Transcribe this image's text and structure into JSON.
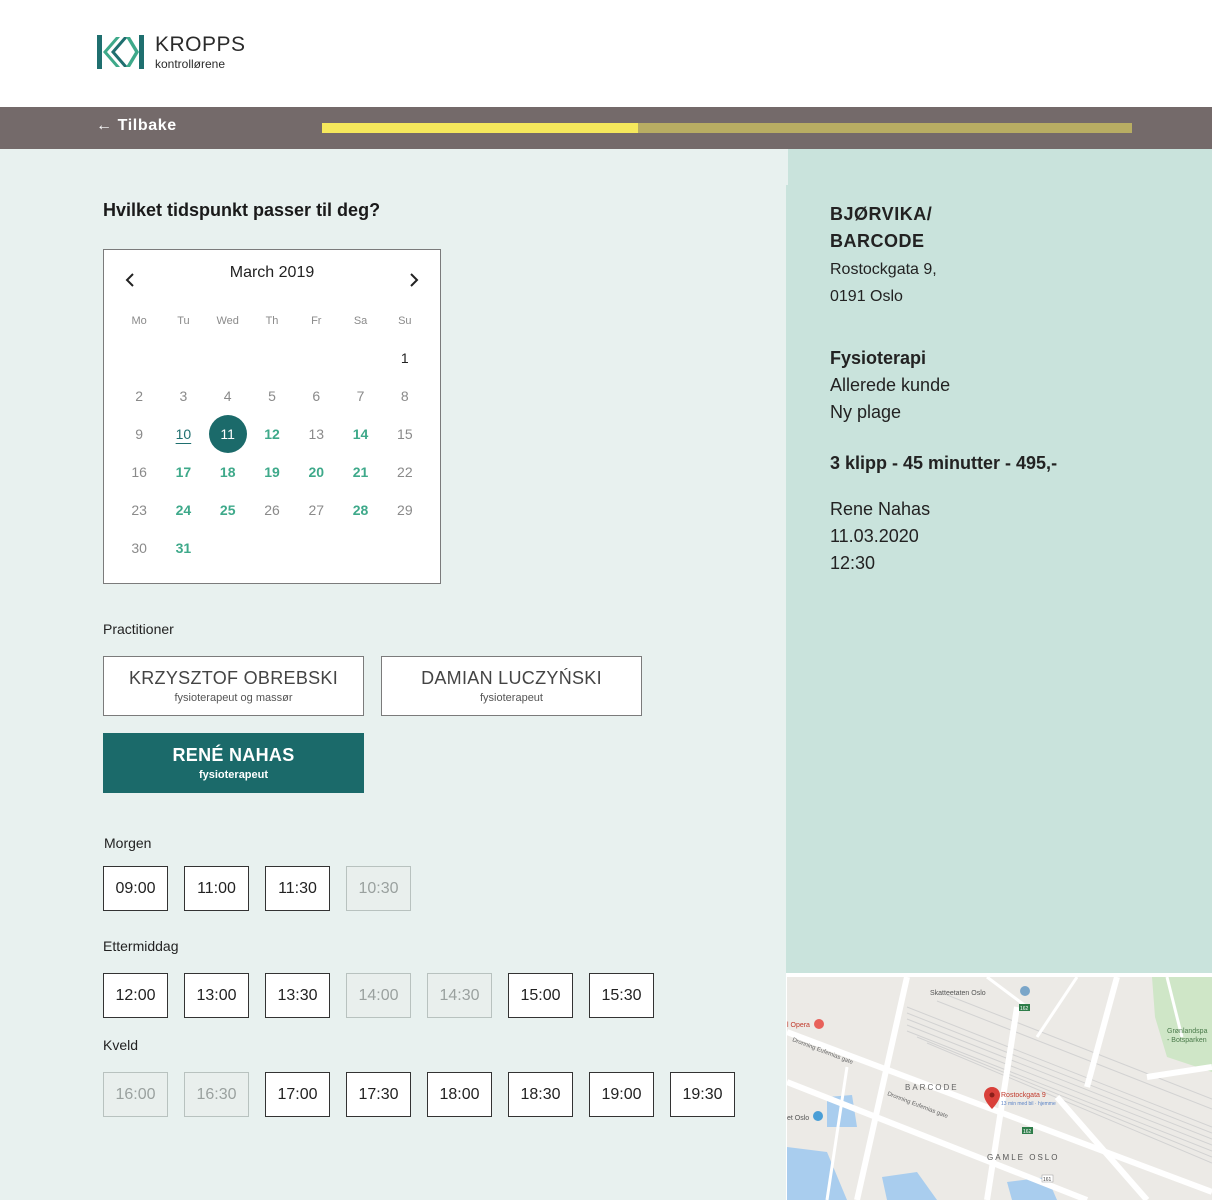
{
  "brand": {
    "title": "KROPPS",
    "subtitle": "kontrollørene"
  },
  "nav": {
    "back_label": "← Tilbake",
    "progress": 0.39
  },
  "colors": {
    "accent": "#1b6a6a",
    "available": "#3ea98a",
    "panel": "#c9e3dc",
    "bar": "#746a6a",
    "progress_fill": "#f5e85c",
    "progress_track": "#b8ad63"
  },
  "question": "Hvilket tidspunkt passer til deg?",
  "calendar": {
    "month_label": "March 2019",
    "prev_icon": "chevron-left-icon",
    "next_icon": "chevron-right-icon",
    "weekdays": [
      "Mo",
      "Tu",
      "Wed",
      "Th",
      "Fr",
      "Sa",
      "Su"
    ],
    "weeks": [
      [
        "",
        "",
        "",
        "",
        "",
        "",
        "1"
      ],
      [
        "2",
        "3",
        "4",
        "5",
        "6",
        "7",
        "8"
      ],
      [
        "9",
        "10",
        "11",
        "12",
        "13",
        "14",
        "15"
      ],
      [
        "16",
        "17",
        "18",
        "19",
        "20",
        "21",
        "22"
      ],
      [
        "23",
        "24",
        "25",
        "26",
        "27",
        "28",
        "29"
      ],
      [
        "30",
        "31",
        "",
        "",
        "",
        "",
        ""
      ]
    ],
    "selected": "11",
    "today": "10",
    "available": [
      "12",
      "14",
      "17",
      "18",
      "19",
      "20",
      "21",
      "24",
      "25",
      "28",
      "31"
    ],
    "normal": [
      "1"
    ]
  },
  "practitioner_label": "Practitioner",
  "practitioners": [
    {
      "name": "KRZYSZTOF OBREBSKI",
      "role": "fysioterapeut og massør",
      "selected": false
    },
    {
      "name": "DAMIAN LUCZYŃSKI",
      "role": "fysioterapeut",
      "selected": false
    },
    {
      "name": "RENÉ NAHAS",
      "role": "fysioterapeut",
      "selected": true
    }
  ],
  "time_groups": [
    {
      "label": "Morgen",
      "slots": [
        {
          "time": "09:00",
          "disabled": false
        },
        {
          "time": "11:00",
          "disabled": false
        },
        {
          "time": "11:30",
          "disabled": false
        },
        {
          "time": "10:30",
          "disabled": true
        }
      ]
    },
    {
      "label": "Ettermiddag",
      "slots": [
        {
          "time": "12:00",
          "disabled": false
        },
        {
          "time": "13:00",
          "disabled": false
        },
        {
          "time": "13:30",
          "disabled": false
        },
        {
          "time": "14:00",
          "disabled": true
        },
        {
          "time": "14:30",
          "disabled": true
        },
        {
          "time": "15:00",
          "disabled": false
        },
        {
          "time": "15:30",
          "disabled": false
        }
      ]
    },
    {
      "label": "Kveld",
      "slots": [
        {
          "time": "16:00",
          "disabled": true
        },
        {
          "time": "16:30",
          "disabled": true
        },
        {
          "time": "17:00",
          "disabled": false
        },
        {
          "time": "17:30",
          "disabled": false
        },
        {
          "time": "18:00",
          "disabled": false
        },
        {
          "time": "18:30",
          "disabled": false
        },
        {
          "time": "19:00",
          "disabled": false
        },
        {
          "time": "19:30",
          "disabled": false
        }
      ]
    }
  ],
  "summary": {
    "clinic_line1": "BJØRVIKA/",
    "clinic_line2": "BARCODE",
    "address_line1": "Rostockgata 9,",
    "address_line2": "0191 Oslo",
    "service": "Fysioterapi",
    "customer_type": "Allerede kunde",
    "complaint": "Ny plage",
    "package": "3 klipp - 45 minutter - 495,-",
    "practitioner": "Rene Nahas",
    "date": "11.03.2020",
    "time": "12:30"
  },
  "map": {
    "labels": {
      "skatteetaten": "Skatteetaten Oslo",
      "opera": "l Opera",
      "opera_oslo": "et Oslo",
      "street1": "Dronning Eufemias gate",
      "street2": "Dronning Eufemias gate",
      "barcode": "BARCODE",
      "pin_title": "Rostockgata 9",
      "pin_sub": "13 min med bil · hjemme",
      "gamle": "GAMLE OSLO",
      "gronland1": "Grønlandspa",
      "gronland2": "- Botsparken",
      "road_162": "162",
      "road_162b": "162",
      "road_161": "161"
    },
    "pin_icon": "map-pin-icon"
  }
}
